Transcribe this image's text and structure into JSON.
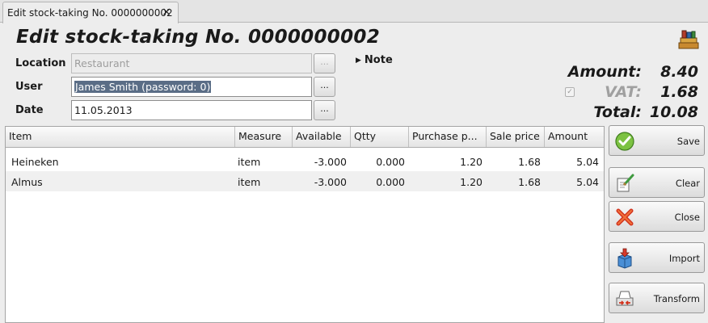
{
  "tab": {
    "label": "Edit stock-taking No. 0000000002",
    "close": "×"
  },
  "header": {
    "title": "Edit stock-taking No. 0000000002"
  },
  "form": {
    "location_label": "Location",
    "location_value": "Restaurant",
    "user_label": "User",
    "user_value": "James Smith (password: 0)",
    "date_label": "Date",
    "date_value": "11.05.2013",
    "dots": "...",
    "note_label": "Note"
  },
  "totals": {
    "amount_label": "Amount:",
    "amount_value": "8.40",
    "vat_label": "VAT:",
    "vat_value": "1.68",
    "total_label": "Total:",
    "total_value": "10.08"
  },
  "table": {
    "columns": [
      "Item",
      "Measure",
      "Available",
      "Qtty",
      "Purchase p...",
      "Sale price",
      "Amount"
    ],
    "rows": [
      [
        "Heineken",
        "item",
        "-3.000",
        "0.000",
        "1.20",
        "1.68",
        "5.04"
      ],
      [
        "Almus",
        "item",
        "-3.000",
        "0.000",
        "1.20",
        "1.68",
        "5.04"
      ]
    ]
  },
  "buttons": {
    "save": "Save",
    "clear": "Clear",
    "close": "Close",
    "import": "Import",
    "transform": "Transform"
  }
}
